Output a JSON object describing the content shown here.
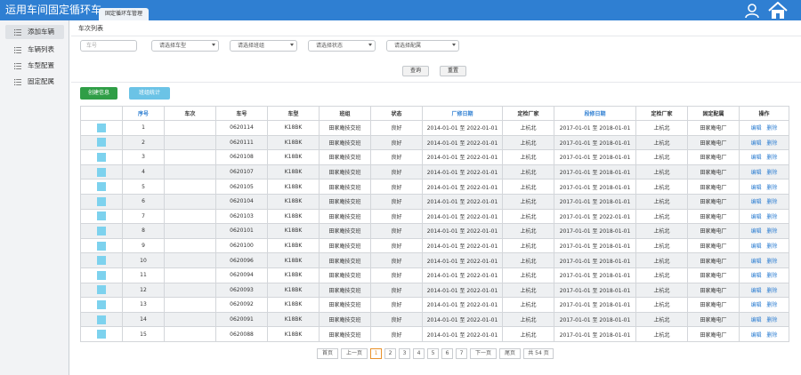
{
  "app": {
    "title": "运用车间固定循环车",
    "tab": "固定循环车管理"
  },
  "icons": {
    "user": "user-icon",
    "home": "home-icon"
  },
  "sidebar": {
    "items": [
      {
        "label": "添加车辆",
        "active": true
      },
      {
        "label": "车辆列表",
        "active": false
      },
      {
        "label": "车型配置",
        "active": false
      },
      {
        "label": "固定配属",
        "active": false
      }
    ]
  },
  "breadcrumb": "车次列表",
  "filters": {
    "plate_placeholder": "车号",
    "car_type": "请选择车型",
    "team": "请选择班组",
    "status": "请选择状态",
    "assign": "请选择配属"
  },
  "buttons": {
    "search": "查询",
    "reset": "重置",
    "create": "创建信息",
    "shift_stats": "班组统计"
  },
  "colors": {
    "accent": "#2f7fd2",
    "create": "#2f9e46",
    "shift": "#6bc3e6",
    "swatch": "#7dd2ee",
    "pager_active": "#e8912b"
  },
  "table": {
    "headers": [
      "",
      "序号",
      "车次",
      "车号",
      "车型",
      "班组",
      "状态",
      "厂修日期",
      "定检厂家",
      "段修日期",
      "定检厂家",
      "固定配属",
      "操作"
    ],
    "actions": {
      "edit": "编辑",
      "delete": "删除"
    },
    "rows": [
      {
        "no": "1",
        "train": "",
        "plate": "0620114",
        "type": "K18BK",
        "team": "田家庵技交班",
        "status": "良好",
        "factory": "2014-01-01 至 2022-01-01",
        "factory_insp": "上杭北",
        "section": "2017-01-01 至 2018-01-01",
        "section_insp": "上杭北",
        "assign": "田家庵电厂"
      },
      {
        "no": "2",
        "train": "",
        "plate": "0620111",
        "type": "K18BK",
        "team": "田家庵技交班",
        "status": "良好",
        "factory": "2014-01-01 至 2022-01-01",
        "factory_insp": "上杭北",
        "section": "2017-01-01 至 2018-01-01",
        "section_insp": "上杭北",
        "assign": "田家庵电厂"
      },
      {
        "no": "3",
        "train": "",
        "plate": "0620108",
        "type": "K18BK",
        "team": "田家庵技交班",
        "status": "良好",
        "factory": "2014-01-01 至 2022-01-01",
        "factory_insp": "上杭北",
        "section": "2017-01-01 至 2018-01-01",
        "section_insp": "上杭北",
        "assign": "田家庵电厂"
      },
      {
        "no": "4",
        "train": "",
        "plate": "0620107",
        "type": "K18BK",
        "team": "田家庵技交班",
        "status": "良好",
        "factory": "2014-01-01 至 2022-01-01",
        "factory_insp": "上杭北",
        "section": "2017-01-01 至 2018-01-01",
        "section_insp": "上杭北",
        "assign": "田家庵电厂"
      },
      {
        "no": "5",
        "train": "",
        "plate": "0620105",
        "type": "K18BK",
        "team": "田家庵技交班",
        "status": "良好",
        "factory": "2014-01-01 至 2022-01-01",
        "factory_insp": "上杭北",
        "section": "2017-01-01 至 2018-01-01",
        "section_insp": "上杭北",
        "assign": "田家庵电厂"
      },
      {
        "no": "6",
        "train": "",
        "plate": "0620104",
        "type": "K18BK",
        "team": "田家庵技交班",
        "status": "良好",
        "factory": "2014-01-01 至 2022-01-01",
        "factory_insp": "上杭北",
        "section": "2017-01-01 至 2018-01-01",
        "section_insp": "上杭北",
        "assign": "田家庵电厂"
      },
      {
        "no": "7",
        "train": "",
        "plate": "0620103",
        "type": "K18BK",
        "team": "田家庵技交班",
        "status": "良好",
        "factory": "2014-01-01 至 2022-01-01",
        "factory_insp": "上杭北",
        "section": "2017-01-01 至 2022-01-01",
        "section_insp": "上杭北",
        "assign": "田家庵电厂"
      },
      {
        "no": "8",
        "train": "",
        "plate": "0620101",
        "type": "K18BK",
        "team": "田家庵技交班",
        "status": "良好",
        "factory": "2014-01-01 至 2022-01-01",
        "factory_insp": "上杭北",
        "section": "2017-01-01 至 2018-01-01",
        "section_insp": "上杭北",
        "assign": "田家庵电厂"
      },
      {
        "no": "9",
        "train": "",
        "plate": "0620100",
        "type": "K18BK",
        "team": "田家庵技交班",
        "status": "良好",
        "factory": "2014-01-01 至 2022-01-01",
        "factory_insp": "上杭北",
        "section": "2017-01-01 至 2018-01-01",
        "section_insp": "上杭北",
        "assign": "田家庵电厂"
      },
      {
        "no": "10",
        "train": "",
        "plate": "0620096",
        "type": "K18BK",
        "team": "田家庵技交班",
        "status": "良好",
        "factory": "2014-01-01 至 2022-01-01",
        "factory_insp": "上杭北",
        "section": "2017-01-01 至 2018-01-01",
        "section_insp": "上杭北",
        "assign": "田家庵电厂"
      },
      {
        "no": "11",
        "train": "",
        "plate": "0620094",
        "type": "K18BK",
        "team": "田家庵技交班",
        "status": "良好",
        "factory": "2014-01-01 至 2022-01-01",
        "factory_insp": "上杭北",
        "section": "2017-01-01 至 2018-01-01",
        "section_insp": "上杭北",
        "assign": "田家庵电厂"
      },
      {
        "no": "12",
        "train": "",
        "plate": "0620093",
        "type": "K18BK",
        "team": "田家庵技交班",
        "status": "良好",
        "factory": "2014-01-01 至 2022-01-01",
        "factory_insp": "上杭北",
        "section": "2017-01-01 至 2018-01-01",
        "section_insp": "上杭北",
        "assign": "田家庵电厂"
      },
      {
        "no": "13",
        "train": "",
        "plate": "0620092",
        "type": "K18BK",
        "team": "田家庵技交班",
        "status": "良好",
        "factory": "2014-01-01 至 2022-01-01",
        "factory_insp": "上杭北",
        "section": "2017-01-01 至 2018-01-01",
        "section_insp": "上杭北",
        "assign": "田家庵电厂"
      },
      {
        "no": "14",
        "train": "",
        "plate": "0620091",
        "type": "K18BK",
        "team": "田家庵技交班",
        "status": "良好",
        "factory": "2014-01-01 至 2022-01-01",
        "factory_insp": "上杭北",
        "section": "2017-01-01 至 2018-01-01",
        "section_insp": "上杭北",
        "assign": "田家庵电厂"
      },
      {
        "no": "15",
        "train": "",
        "plate": "0620088",
        "type": "K18BK",
        "team": "田家庵技交班",
        "status": "良好",
        "factory": "2014-01-01 至 2022-01-01",
        "factory_insp": "上杭北",
        "section": "2017-01-01 至 2018-01-01",
        "section_insp": "上杭北",
        "assign": "田家庵电厂"
      }
    ]
  },
  "pagination": {
    "first": "首页",
    "prev": "上一页",
    "pages": [
      "1",
      "2",
      "3",
      "4",
      "5",
      "6",
      "7"
    ],
    "current": "1",
    "next": "下一页",
    "last": "尾页",
    "total": "共 54 页"
  }
}
